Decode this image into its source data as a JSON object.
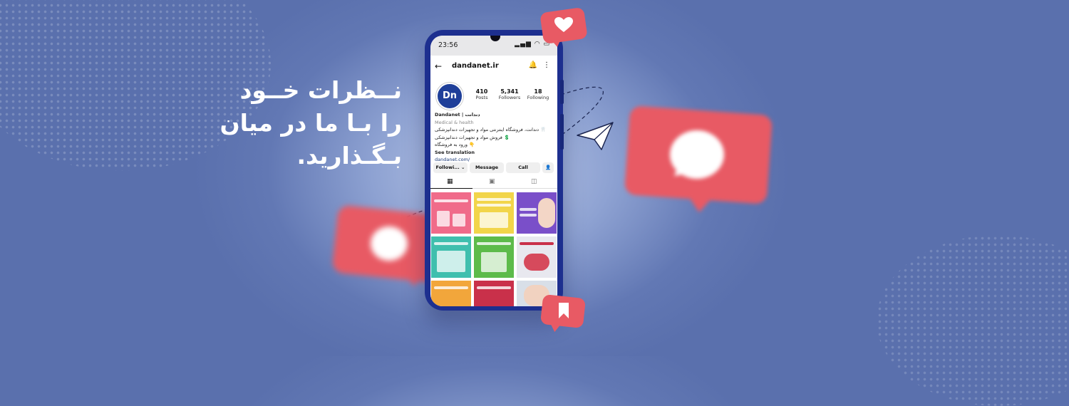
{
  "headline": {
    "line1": "نــظرات خــود",
    "line2": "را بـا ما در میان",
    "line3": "بـگـذارید."
  },
  "colors": {
    "background": "#6278b4",
    "bubble_red": "#e85a64",
    "phone_frame": "#1d2f8f",
    "avatar": "#1f3f99"
  },
  "phone": {
    "status_time": "23:56",
    "status_icons": "signal-icon wifi-icon battery-icon"
  },
  "profile": {
    "username": "dandanet.ir",
    "avatar_text": "Dn",
    "posts_count": "410",
    "posts_label": "Posts",
    "followers_count": "5,341",
    "followers_label": "Followers",
    "following_count": "18",
    "following_label": "Following",
    "name": "Dandanet | دندانت",
    "category": "Medical & health",
    "bio_line1": "🦷 دندانت، فروشگاه اینترنتی مواد و تجهیزات دندانپزشکی",
    "bio_line2": "💲 فروش مواد و تجهیزات دندانپزشکی",
    "bio_line3": "👇 ورود به فروشگاه",
    "see_translation": "See translation",
    "website": "dandanet.com/"
  },
  "buttons": {
    "following": "Followi... ⌄",
    "message": "Message",
    "call": "Call"
  },
  "icons": [
    "back-arrow-icon",
    "bell-icon",
    "more-icon",
    "add-person-icon",
    "grid-icon",
    "reels-icon",
    "tagged-icon",
    "heart-icon",
    "chat-icon",
    "paper-plane-icon",
    "bookmark-icon"
  ],
  "posts": [
    {
      "bg": "#f06b8a"
    },
    {
      "bg": "#f2d54a"
    },
    {
      "bg": "#7a4fc9"
    },
    {
      "bg": "#3fbfae"
    },
    {
      "bg": "#5dbb4a"
    },
    {
      "bg": "#e8e8ef"
    },
    {
      "bg": "#f2a63b"
    },
    {
      "bg": "#c9304a"
    },
    {
      "bg": "#d8dfe8"
    }
  ]
}
